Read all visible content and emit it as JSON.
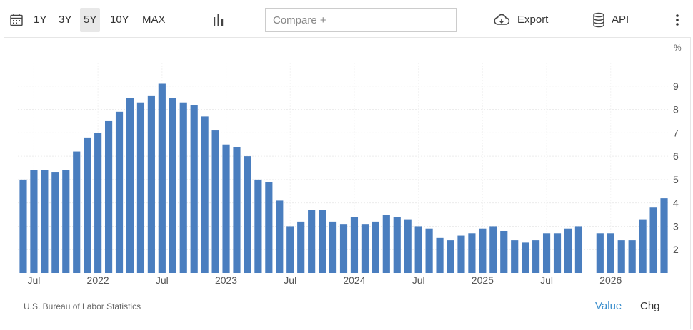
{
  "toolbar": {
    "ranges": [
      "1Y",
      "3Y",
      "5Y",
      "10Y",
      "MAX"
    ],
    "active_range": "5Y",
    "compare_placeholder": "Compare +",
    "export_label": "Export",
    "api_label": "API"
  },
  "chart_data": {
    "type": "bar",
    "unit": "%",
    "ylim": [
      1,
      10
    ],
    "yticks": [
      2,
      3,
      4,
      5,
      6,
      7,
      8,
      9
    ],
    "grid": true,
    "bar_color": "#4a7ebf",
    "x_axis_labels": [
      {
        "label": "Jul",
        "month_index": 1
      },
      {
        "label": "2022",
        "month_index": 7
      },
      {
        "label": "Jul",
        "month_index": 13
      },
      {
        "label": "2023",
        "month_index": 19
      },
      {
        "label": "Jul",
        "month_index": 25
      },
      {
        "label": "2024",
        "month_index": 31
      },
      {
        "label": "Jul",
        "month_index": 37
      },
      {
        "label": "2025",
        "month_index": 43
      },
      {
        "label": "Jul",
        "month_index": 49
      },
      {
        "label": "2026",
        "month_index": 55
      }
    ],
    "values": [
      5.0,
      5.4,
      5.4,
      5.3,
      5.4,
      6.2,
      6.8,
      7.0,
      7.5,
      7.9,
      8.5,
      8.3,
      8.6,
      9.1,
      8.5,
      8.3,
      8.2,
      7.7,
      7.1,
      6.5,
      6.4,
      6.0,
      5.0,
      4.9,
      4.1,
      3.0,
      3.2,
      3.7,
      3.7,
      3.2,
      3.1,
      3.4,
      3.1,
      3.2,
      3.5,
      3.4,
      3.3,
      3.0,
      2.9,
      2.5,
      2.4,
      2.6,
      2.7,
      2.9,
      3.0,
      2.8,
      2.4,
      2.3,
      2.4,
      2.7,
      2.7,
      2.9,
      3.0,
      null,
      2.7,
      2.7,
      2.4,
      2.4,
      3.3,
      3.8,
      4.2
    ]
  },
  "footer": {
    "source": "U.S. Bureau of Labor Statistics",
    "value_tab": "Value",
    "chg_tab": "Chg"
  }
}
